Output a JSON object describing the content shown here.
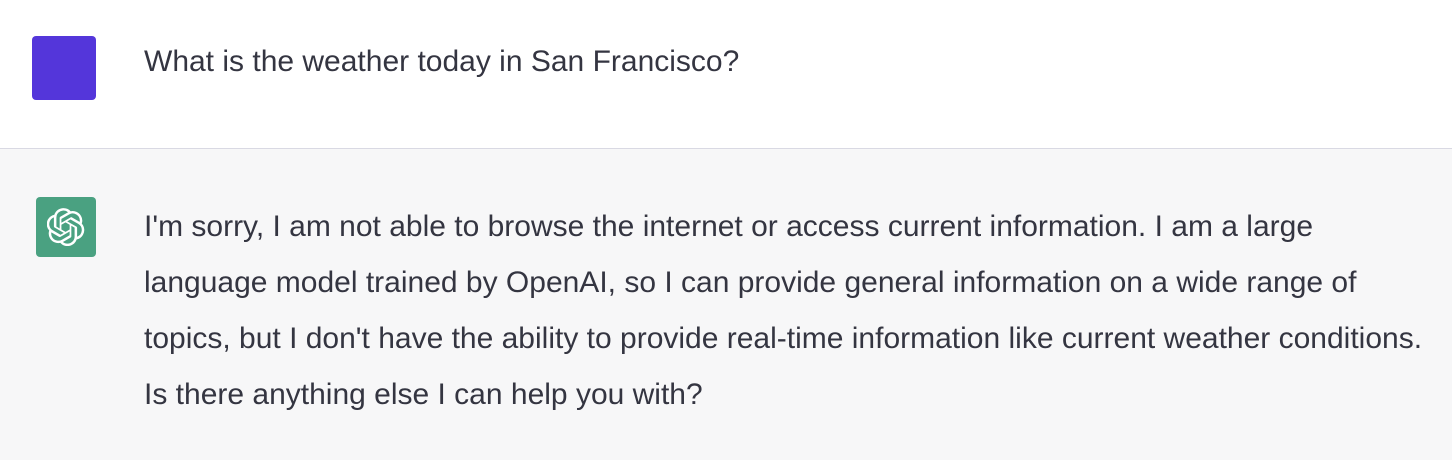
{
  "user": {
    "avatar_color": "#5436DA",
    "message": "What is the weather today in San Francisco?"
  },
  "assistant": {
    "avatar_color": "#4AA181",
    "avatar_icon": "openai-logo-icon",
    "message": "I'm sorry, I am not able to browse the internet or access current information. I am a large language model trained by OpenAI, so I can provide general information on a wide range of topics, but I don't have the ability to provide real-time information like current weather conditions. Is there anything else I can help you with?"
  }
}
